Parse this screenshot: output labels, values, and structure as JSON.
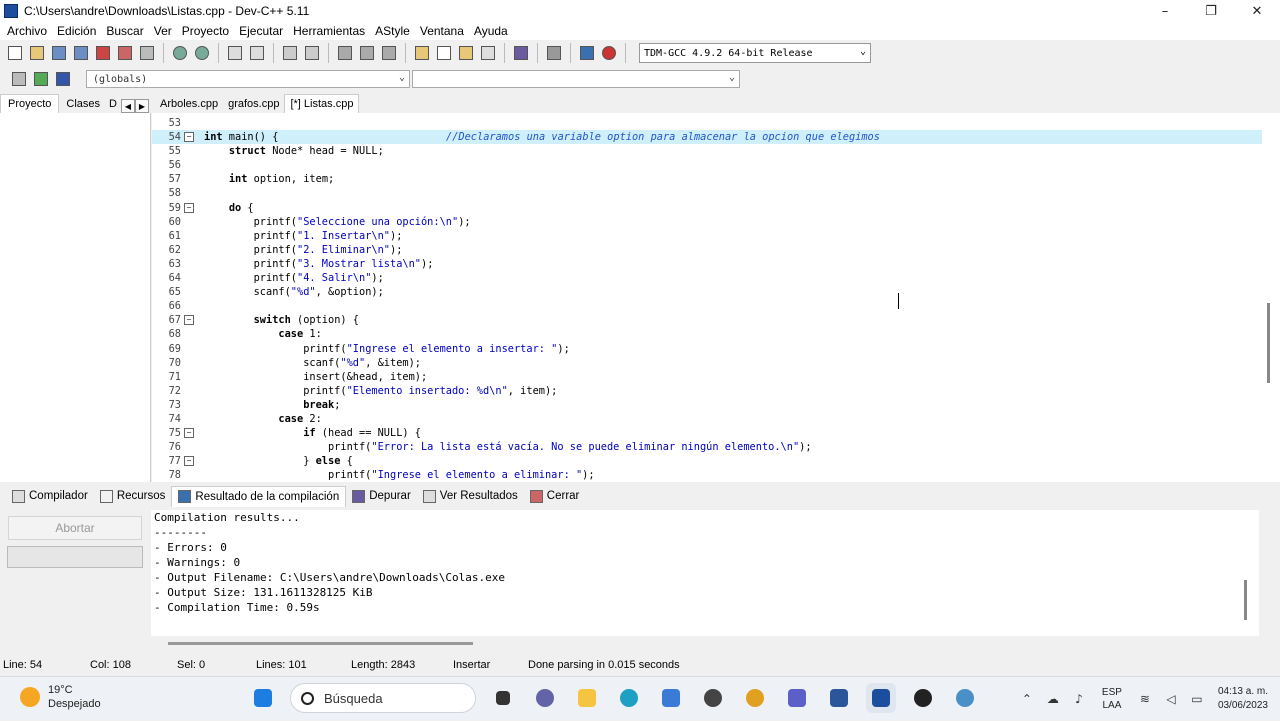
{
  "window": {
    "title": "C:\\Users\\andre\\Downloads\\Listas.cpp - Dev-C++ 5.11",
    "controls": [
      "–",
      "❐",
      "✕"
    ]
  },
  "menu": [
    "Archivo",
    "Edición",
    "Buscar",
    "Ver",
    "Proyecto",
    "Ejecutar",
    "Herramientas",
    "AStyle",
    "Ventana",
    "Ayuda"
  ],
  "toolbar": {
    "compiler": "TDM-GCC 4.9.2 64-bit Release"
  },
  "toolbar2": {
    "scope": "(globals)",
    "function": ""
  },
  "left_tabs": [
    "Proyecto",
    "Clases",
    "D"
  ],
  "file_tabs": [
    "Arboles.cpp",
    "grafos.cpp",
    "[*] Listas.cpp"
  ],
  "code": {
    "lines": [
      {
        "n": "53",
        "t": ""
      },
      {
        "n": "54",
        "t": "int main() {",
        "cm": "//Declaramos una variable option para almacenar la opcion que elegimos",
        "fold": true,
        "hl": true
      },
      {
        "n": "55",
        "t": "    struct Node* head = NULL;"
      },
      {
        "n": "56",
        "t": ""
      },
      {
        "n": "57",
        "t": "    int option, item;"
      },
      {
        "n": "58",
        "t": ""
      },
      {
        "n": "59",
        "t": "    do {",
        "fold": true
      },
      {
        "n": "60",
        "t": "        printf(\"Seleccione una opción:\\n\");"
      },
      {
        "n": "61",
        "t": "        printf(\"1. Insertar\\n\");"
      },
      {
        "n": "62",
        "t": "        printf(\"2. Eliminar\\n\");"
      },
      {
        "n": "63",
        "t": "        printf(\"3. Mostrar lista\\n\");"
      },
      {
        "n": "64",
        "t": "        printf(\"4. Salir\\n\");"
      },
      {
        "n": "65",
        "t": "        scanf(\"%d\", &option);"
      },
      {
        "n": "66",
        "t": ""
      },
      {
        "n": "67",
        "t": "        switch (option) {",
        "fold": true
      },
      {
        "n": "68",
        "t": "            case 1:"
      },
      {
        "n": "69",
        "t": "                printf(\"Ingrese el elemento a insertar: \");"
      },
      {
        "n": "70",
        "t": "                scanf(\"%d\", &item);"
      },
      {
        "n": "71",
        "t": "                insert(&head, item);"
      },
      {
        "n": "72",
        "t": "                printf(\"Elemento insertado: %d\\n\", item);"
      },
      {
        "n": "73",
        "t": "                break;"
      },
      {
        "n": "74",
        "t": "            case 2:"
      },
      {
        "n": "75",
        "t": "                if (head == NULL) {",
        "fold": true
      },
      {
        "n": "76",
        "t": "                    printf(\"Error: La lista está vacía. No se puede eliminar ningún elemento.\\n\");"
      },
      {
        "n": "77",
        "t": "                } else {",
        "fold": true
      },
      {
        "n": "78",
        "t": "                    printf(\"Ingrese el elemento a eliminar: \");"
      }
    ]
  },
  "bottom_tabs": [
    "Compilador",
    "Recursos",
    "Resultado de la compilación",
    "Depurar",
    "Ver Resultados",
    "Cerrar"
  ],
  "compile": {
    "abort_label": "Abortar",
    "output": [
      "Compilation results...",
      "--------",
      "- Errors: 0",
      "- Warnings: 0",
      "- Output Filename: C:\\Users\\andre\\Downloads\\Colas.exe",
      "- Output Size: 131.1611328125 KiB",
      "- Compilation Time: 0.59s"
    ]
  },
  "status": {
    "line": "Line:   54",
    "col": "Col:   108",
    "sel": "Sel:    0",
    "lines": "Lines:   101",
    "length": "Length:  2843",
    "mode": "Insertar",
    "message": "Done parsing in 0.015 seconds"
  },
  "taskbar": {
    "temp": "19°C",
    "weather": "Despejado",
    "search_placeholder": "Búsqueda",
    "lang1": "ESP",
    "lang2": "LAA",
    "time": "04:13 a. m.",
    "date": "03/06/2023"
  }
}
